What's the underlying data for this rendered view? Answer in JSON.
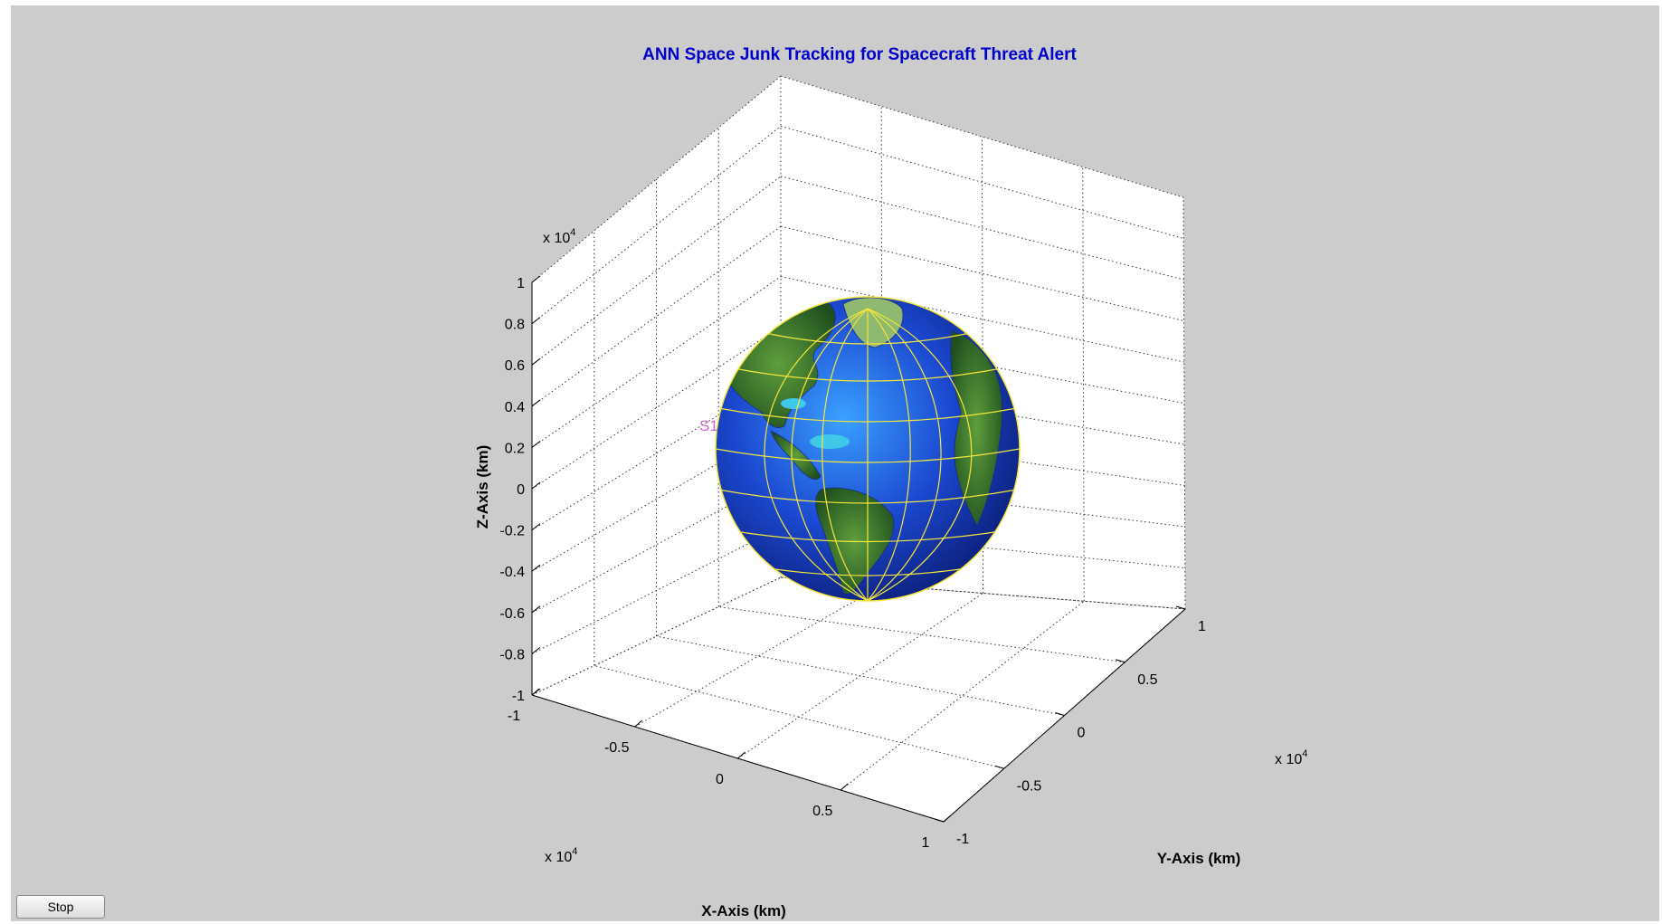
{
  "figure": {
    "title": "ANN Space Junk Tracking for Spacecraft Threat Alert",
    "stop_button_label": "Stop",
    "satellite_label": "S1",
    "colors": {
      "title": "#0000cc",
      "figure_background": "#cccccc",
      "axes_background": "#ffffff",
      "globe_grid": "#f5e63c",
      "globe_ocean": "#1840c8",
      "globe_land": "#2f6b2a",
      "satellite_label": "#cc66cc"
    }
  },
  "chart_data": {
    "type": "3d-surface",
    "xlabel": "X-Axis (km)",
    "ylabel": "Y-Axis (km)",
    "zlabel": "Z-Axis (km)",
    "xlim": [
      -10000,
      10000
    ],
    "ylim": [
      -10000,
      10000
    ],
    "zlim": [
      -10000,
      10000
    ],
    "grid": true,
    "exponent_label": "x 10",
    "exponent_power": "4",
    "x_ticks": [
      "-1",
      "-0.5",
      "0",
      "0.5",
      "1"
    ],
    "y_ticks": [
      "-1",
      "-0.5",
      "0",
      "0.5",
      "1"
    ],
    "z_ticks": [
      "1",
      "0.8",
      "0.6",
      "0.4",
      "0.2",
      "0",
      "-0.2",
      "-0.4",
      "-0.6",
      "-0.8",
      "-1"
    ],
    "objects": [
      {
        "name": "Earth",
        "type": "sphere",
        "center": [
          0,
          0,
          0
        ],
        "radius_km": 6371
      }
    ]
  }
}
